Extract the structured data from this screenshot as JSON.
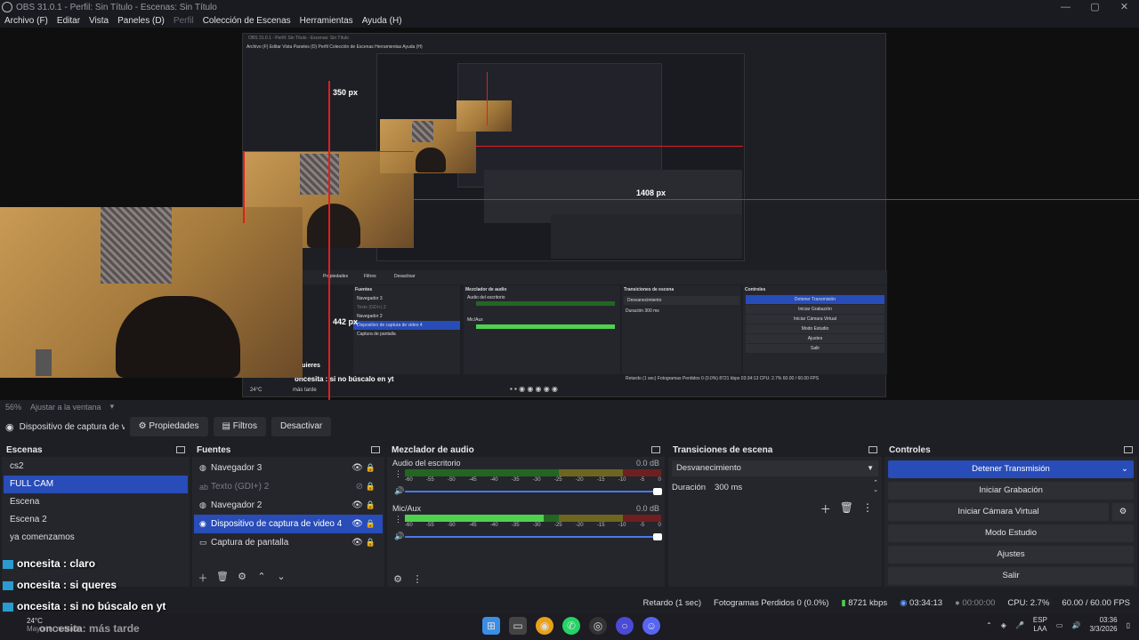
{
  "titlebar": {
    "title": "OBS 31.0.1 - Perfil: Sin Título - Escenas: Sin Título",
    "minimize": "—",
    "maximize": "▢",
    "close": "✕"
  },
  "menu": [
    "Archivo (F)",
    "Editar",
    "Vista",
    "Paneles (D)",
    "Perfil",
    "Colección de Escenas",
    "Herramientas",
    "Ayuda (H)"
  ],
  "preview": {
    "label_350": "350 px",
    "label_442": "442 px",
    "label_1408": "1408 px",
    "nested_title": "OBS 31.0.1 - Perfil: Sin Título - Escenas: Sin Título",
    "nested_menu": "Archivo (F)   Editar   Vista   Paneles (D)   Perfil   Colección de Escenas   Herramientas   Ayuda (H)",
    "nested_props": "Propiedades",
    "nested_filters": "Filtros",
    "nested_deact": "Desactivar",
    "nested_sources_h": "Fuentes",
    "nested_mixer_h": "Mezclador de audio",
    "nested_trans_h": "Transiciones de escena",
    "nested_ctrl_h": "Controles",
    "nested_src": [
      "Navegador 3",
      "Texto (GDI+) 2",
      "Navegador 2",
      "Dispositivo de captura de video 4",
      "Captura de pantalla"
    ],
    "nested_audio1": "Audio del escritorio",
    "nested_audio2": "Mic/Aux",
    "nested_trans": "Desvanecimiento",
    "nested_dur": "Duración   300 ms",
    "nested_ctrls": [
      "Detener Transmisión",
      "Iniciar Grabación",
      "Iniciar Cámara Virtual",
      "Modo Estudio",
      "Ajustes",
      "Salir"
    ],
    "nested_status": "Retardo (1 sec)     Fotogramas Perdidos 0 (0.0%)     8721 kbps    03:34:13     CPU: 2.7%   60.00 / 60.00 FPS",
    "nested_chat": "oncesita : si no búscalo en yt",
    "nested_chat2": "quieres",
    "nested_weather": "24°C",
    "nested_later": "más tarde"
  },
  "zoom": {
    "percent": "56%",
    "fit": "Ajustar a la ventana"
  },
  "source_toolbar": {
    "source": "Dispositivo de captura de v",
    "props": "Propiedades",
    "filters": "Filtros",
    "deactivate": "Desactivar"
  },
  "scenes": {
    "title": "Escenas",
    "items": [
      "cs2",
      "FULL CAM",
      "Escena",
      "Escena 2",
      "ya comenzamos"
    ]
  },
  "sources": {
    "title": "Fuentes",
    "items": [
      "Navegador 3",
      "Texto (GDI+) 2",
      "Navegador 2",
      "Dispositivo de captura de video 4",
      "Captura de pantalla"
    ]
  },
  "mixer": {
    "title": "Mezclador de audio",
    "channels": [
      {
        "name": "Audio del escritorio",
        "db": "0.0 dB",
        "level": 0
      },
      {
        "name": "Mic/Aux",
        "db": "0.0 dB",
        "level": 0.54
      }
    ],
    "ticks": [
      "-60",
      "-55",
      "-50",
      "-45",
      "-40",
      "-35",
      "-30",
      "-25",
      "-20",
      "-15",
      "-10",
      "-5",
      "0"
    ]
  },
  "transitions": {
    "title": "Transiciones de escena",
    "selected": "Desvanecimiento",
    "duration_label": "Duración",
    "duration_value": "300 ms"
  },
  "controls": {
    "title": "Controles",
    "stream": "Detener Transmisión",
    "record": "Iniciar Grabación",
    "vcam": "Iniciar Cámara Virtual",
    "studio": "Modo Estudio",
    "settings": "Ajustes",
    "exit": "Salir"
  },
  "status": {
    "delay": "Retardo (1 sec)",
    "dropped": "Fotogramas Perdidos 0 (0.0%)",
    "kbps": "8721 kbps",
    "live_time": "03:34:13",
    "rec_time": "00:00:00",
    "cpu": "CPU: 2.7%",
    "fps": "60.00 / 60.00 FPS"
  },
  "chat": [
    {
      "user": "oncesita",
      "msg": " : claro"
    },
    {
      "user": "oncesita",
      "msg": " : si queres"
    },
    {
      "user": "oncesita",
      "msg": " : si no búscalo en yt"
    }
  ],
  "taskbar": {
    "weather": "24°C",
    "weather_desc": "Mayorm. nublado",
    "lang1": "ESP",
    "lang2": "LAA",
    "time": "03:36",
    "date": "3/3/2026",
    "ghost_chat": "oncesita: más tarde"
  },
  "colors": {
    "accent": "#284cb8",
    "red_guides": "#e01f1f",
    "meter_green": "#4fd14f"
  }
}
